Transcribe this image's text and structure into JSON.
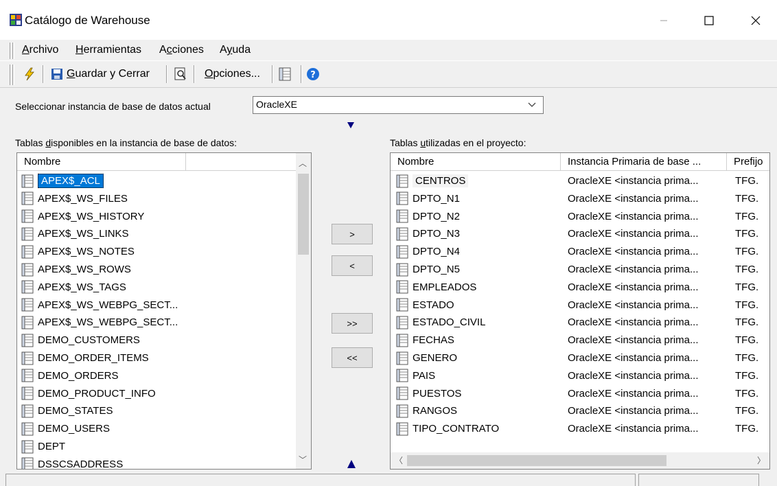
{
  "window": {
    "title": "Catálogo de Warehouse",
    "controls": {
      "minimize": "—",
      "maximize": "☐",
      "close": "✕"
    }
  },
  "menu": [
    {
      "label": "Archivo",
      "mnemonic": "A",
      "rest": "rchivo"
    },
    {
      "label": "Herramientas",
      "mnemonic": "H",
      "rest": "erramientas"
    },
    {
      "label": "Acciones",
      "pre": "A",
      "mnemonic": "c",
      "rest": "ciones"
    },
    {
      "label": "Ayuda",
      "pre": "A",
      "mnemonic": "y",
      "rest": "uda"
    }
  ],
  "toolbar": {
    "save_close_mnemonic": "G",
    "save_close_rest": "uardar y Cerrar",
    "options_mnemonic": "O",
    "options_rest": "pciones..."
  },
  "instance": {
    "label": "Seleccionar instancia de base de datos actual",
    "selected": "OracleXE"
  },
  "left_panel": {
    "label_pre": "Tablas ",
    "label_mnemonic": "d",
    "label_rest": "isponibles en la instancia de base de datos:",
    "columns": [
      "Nombre",
      ""
    ],
    "rows": [
      "APEX$_ACL",
      "APEX$_WS_FILES",
      "APEX$_WS_HISTORY",
      "APEX$_WS_LINKS",
      "APEX$_WS_NOTES",
      "APEX$_WS_ROWS",
      "APEX$_WS_TAGS",
      "APEX$_WS_WEBPG_SECT...",
      "APEX$_WS_WEBPG_SECT...",
      "DEMO_CUSTOMERS",
      "DEMO_ORDER_ITEMS",
      "DEMO_ORDERS",
      "DEMO_PRODUCT_INFO",
      "DEMO_STATES",
      "DEMO_USERS",
      "DEPT",
      "DSSCSADDRESS"
    ],
    "selected_index": 0
  },
  "move_buttons": {
    "add": ">",
    "remove": "<",
    "add_all": ">>",
    "remove_all": "<<"
  },
  "right_panel": {
    "label_pre": "Tablas ",
    "label_mnemonic": "u",
    "label_rest": "tilizadas en el proyecto:",
    "columns": [
      "Nombre",
      "Instancia Primaria de base ...",
      "Prefijo"
    ],
    "instance_value": "OracleXE <instancia prima...",
    "prefix_value": "TFG.",
    "rows": [
      "CENTROS",
      "DPTO_N1",
      "DPTO_N2",
      "DPTO_N3",
      "DPTO_N4",
      "DPTO_N5",
      "EMPLEADOS",
      "ESTADO",
      "ESTADO_CIVIL",
      "FECHAS",
      "GENERO",
      "PAIS",
      "PUESTOS",
      "RANGOS",
      "TIPO_CONTRATO"
    ]
  },
  "colors": {
    "selection": "#0078d7",
    "arrow": "#000080",
    "help": "#1e6fd9"
  }
}
